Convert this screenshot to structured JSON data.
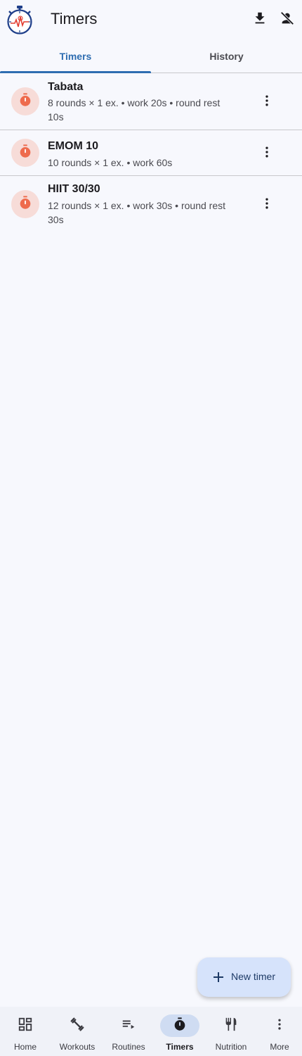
{
  "header": {
    "title": "Timers"
  },
  "tabs": [
    {
      "label": "Timers",
      "active": true
    },
    {
      "label": "History",
      "active": false
    }
  ],
  "timers": [
    {
      "name": "Tabata",
      "description": "8 rounds × 1 ex. • work 20s • round rest 10s"
    },
    {
      "name": "EMOM 10",
      "description": "10 rounds × 1 ex. • work 60s"
    },
    {
      "name": "HIIT 30/30",
      "description": "12 rounds × 1 ex. • work 30s • round rest 30s"
    }
  ],
  "fab": {
    "label": "New timer"
  },
  "bottom_nav": [
    {
      "label": "Home",
      "icon": "dashboard-icon"
    },
    {
      "label": "Workouts",
      "icon": "dumbbell-icon"
    },
    {
      "label": "Routines",
      "icon": "playlist-icon"
    },
    {
      "label": "Timers",
      "icon": "timer-icon",
      "active": true
    },
    {
      "label": "Nutrition",
      "icon": "restaurant-icon"
    },
    {
      "label": "More",
      "icon": "more-vert-icon"
    }
  ],
  "colors": {
    "accent": "#2e6db1",
    "timer_icon": "#ee6b4d",
    "timer_icon_bg": "#f7dcd8",
    "fab_bg": "#d6e3fb"
  }
}
